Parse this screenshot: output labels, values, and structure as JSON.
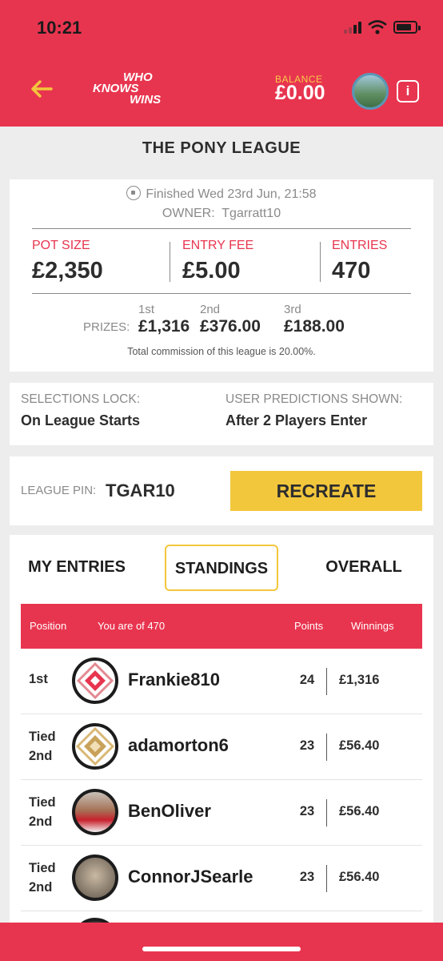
{
  "status_bar": {
    "time": "10:21"
  },
  "header": {
    "logo_lines": [
      "WHO",
      "KNOWS",
      "WINS"
    ],
    "balance_label": "BALANCE",
    "balance_value": "£0.00",
    "info_label": "i"
  },
  "league": {
    "title": "THE PONY LEAGUE",
    "finished_text": "Finished Wed 23rd Jun, 21:58",
    "owner_label": "OWNER:",
    "owner_name": "Tgarratt10",
    "stats": [
      {
        "label": "POT SIZE",
        "value": "£2,350"
      },
      {
        "label": "ENTRY FEE",
        "value": "£5.00"
      },
      {
        "label": "ENTRIES",
        "value": "470"
      }
    ],
    "prizes_label": "PRIZES:",
    "prizes": [
      {
        "place": "1st",
        "amount": "£1,316"
      },
      {
        "place": "2nd",
        "amount": "£376.00"
      },
      {
        "place": "3rd",
        "amount": "£188.00"
      }
    ],
    "commission_text": "Total commission of this league is 20.00%."
  },
  "selections": {
    "lock_label": "SELECTIONS LOCK:",
    "lock_value": "On League Starts",
    "predictions_label": "USER PREDICTIONS SHOWN:",
    "predictions_value": "After 2 Players Enter"
  },
  "pin": {
    "label": "LEAGUE PIN:",
    "value": "TGAR10",
    "recreate_label": "RECREATE"
  },
  "tabs": [
    {
      "label": "MY ENTRIES",
      "active": false
    },
    {
      "label": "STANDINGS",
      "active": true
    },
    {
      "label": "OVERALL",
      "active": false
    }
  ],
  "table": {
    "headers": {
      "position": "Position",
      "you_are": "You are  of 470",
      "points": "Points",
      "winnings": "Winnings"
    },
    "rows": [
      {
        "position": "1st",
        "position_line2": "",
        "name": "Frankie810",
        "points": "24",
        "winnings": "£1,316",
        "avatar": "pattern-avatar-red"
      },
      {
        "position": "Tied",
        "position_line2": "2nd",
        "name": "adamorton6",
        "points": "23",
        "winnings": "£56.40",
        "avatar": "pattern-avatar-gold"
      },
      {
        "position": "Tied",
        "position_line2": "2nd",
        "name": "BenOliver",
        "points": "23",
        "winnings": "£56.40",
        "avatar": "photo-avatar"
      },
      {
        "position": "Tied",
        "position_line2": "2nd",
        "name": "ConnorJSearle",
        "points": "23",
        "winnings": "£56.40",
        "avatar": "photo-avatar"
      }
    ]
  },
  "colors": {
    "brand_red": "#e8354f",
    "accent_yellow": "#f3c73c",
    "balance_label": "#f7c94c"
  }
}
